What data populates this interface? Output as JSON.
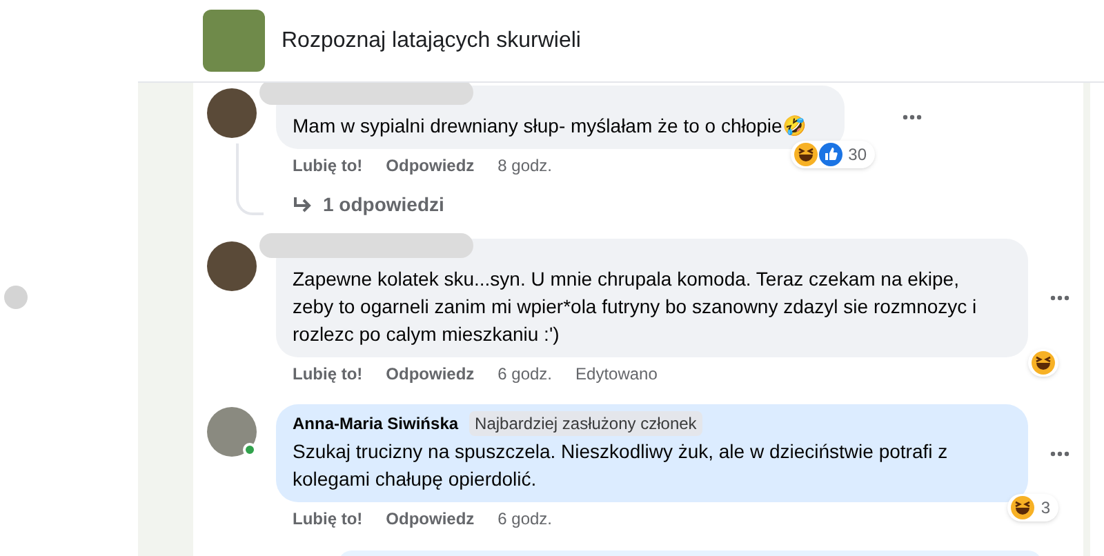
{
  "header": {
    "group_name": "Rozpoznaj latających skurwieli"
  },
  "comments": [
    {
      "redacted": true,
      "online": false,
      "text": "Mam w sypialni drewniany słup- myślałam że to o chłopie🤣",
      "actions": [
        "Lubię to!",
        "Odpowiedz"
      ],
      "time": "8 godz.",
      "reactions": [
        {
          "kind": "haha"
        },
        {
          "kind": "like"
        }
      ],
      "reaction_count": "30",
      "replies": "1 odpowiedzi",
      "highlighted": false
    },
    {
      "redacted": true,
      "online": false,
      "text": "Zapewne kolatek sku...syn. U mnie chrupala komoda. Teraz czekam na ekipe, zeby to ogarneli zanim mi wpier*ola futryny bo szanowny zdazyl sie rozmnozyc i rozlezc po calym mieszkaniu :')",
      "actions": [
        "Lubię to!",
        "Odpowiedz"
      ],
      "time": "6 godz.",
      "edited": "Edytowano",
      "reactions": [
        {
          "kind": "haha"
        }
      ],
      "highlighted": false
    },
    {
      "author": "Anna-Maria Siwińska",
      "badge": "Najbardziej zasłużony członek",
      "redacted": false,
      "online": true,
      "text": "Szukaj trucizny na spuszczela. Nieszkodliwy żuk, ale w dzieciństwie potrafi z kolegami chałupę opierdolić.",
      "actions": [
        "Lubię to!",
        "Odpowiedz"
      ],
      "time": "6 godz.",
      "reactions": [
        {
          "kind": "haha"
        }
      ],
      "reaction_count": "3",
      "highlighted": true
    }
  ]
}
